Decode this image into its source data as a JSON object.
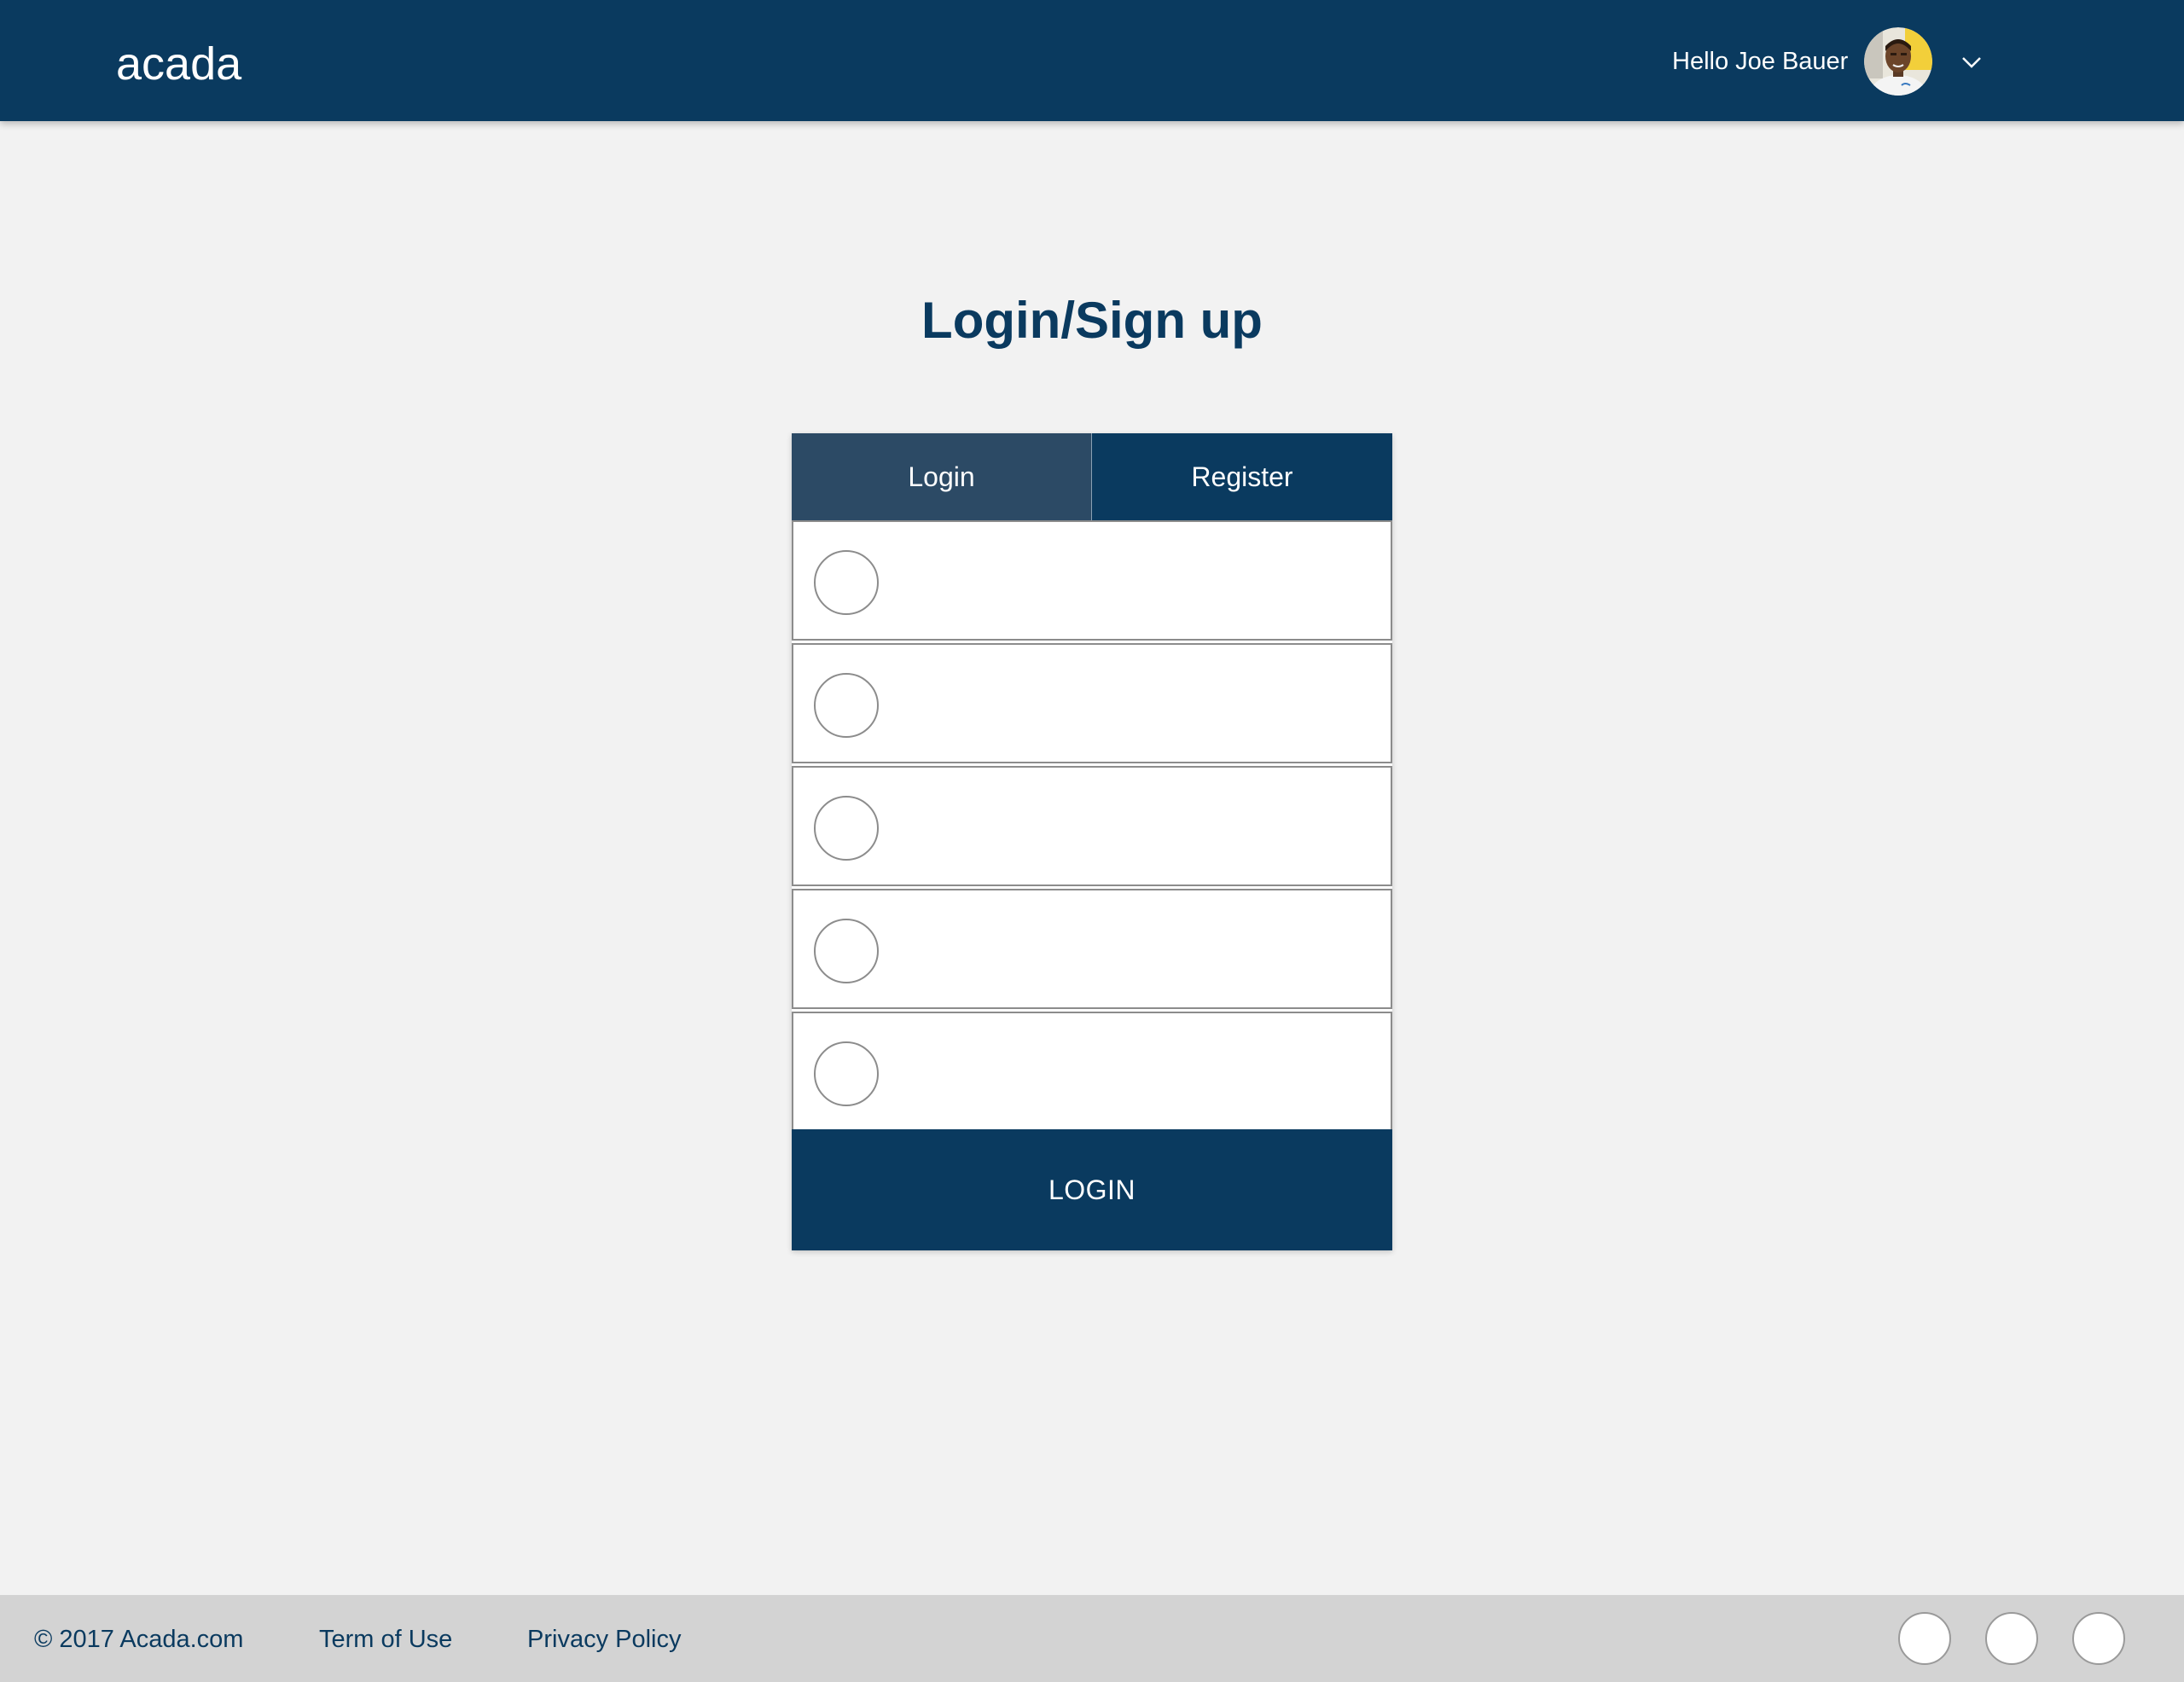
{
  "header": {
    "logo": "acada",
    "greeting": "Hello Joe Bauer",
    "avatar_icon": "user-avatar",
    "menu_icon": "chevron-down-icon"
  },
  "main": {
    "title": "Login/Sign up"
  },
  "auth_card": {
    "tabs": [
      {
        "label": "Login",
        "active": true
      },
      {
        "label": "Register",
        "active": false
      }
    ],
    "fields": [
      {
        "value": "",
        "placeholder": ""
      },
      {
        "value": "",
        "placeholder": ""
      },
      {
        "value": "",
        "placeholder": ""
      },
      {
        "value": "",
        "placeholder": ""
      },
      {
        "value": "",
        "placeholder": ""
      }
    ],
    "submit_label": "LOGIN"
  },
  "footer": {
    "copyright": "© 2017 Acada.com",
    "terms": "Term of Use",
    "privacy": "Privacy Policy",
    "social_icons": [
      "social-icon-1",
      "social-icon-2",
      "social-icon-3"
    ]
  },
  "colors": {
    "primary": "#0a3a5f",
    "active_tab": "#2c4a65",
    "background": "#f2f2f2",
    "footer_bg": "#d3d3d3"
  }
}
